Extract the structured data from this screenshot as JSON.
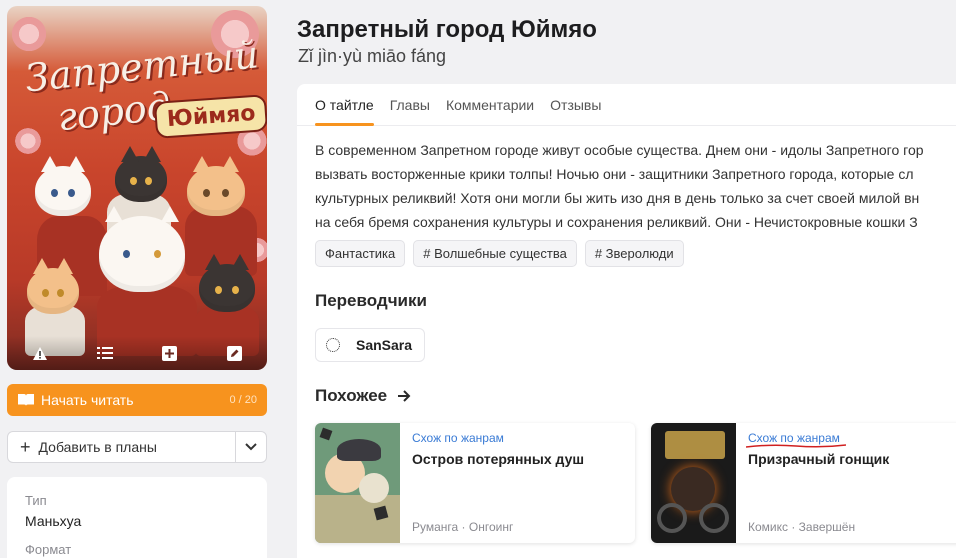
{
  "colors": {
    "accent": "#f7931e",
    "link": "#3a7bd5",
    "red_mark": "#d02020"
  },
  "cover": {
    "art_line1": "Запретный",
    "art_line2": "город",
    "art_badge": "Юймяо",
    "actions": [
      "warning-icon",
      "list-icon",
      "plus-square-icon",
      "edit-icon"
    ]
  },
  "read_button": {
    "label": "Начать читать",
    "progress": "0 / 20"
  },
  "plans_button": {
    "label": "Добавить в планы"
  },
  "info": [
    {
      "label": "Тип",
      "value": "Маньхуа"
    },
    {
      "label": "Формат",
      "value": ""
    }
  ],
  "header": {
    "title": "Запретный город Юймяо",
    "subtitle": "Zǐ jìn·yù miāo fáng"
  },
  "tabs": [
    "О тайтле",
    "Главы",
    "Комментарии",
    "Отзывы"
  ],
  "description": [
    "В современном Запретном городе живут особые существа. Днем они - идолы Запретного гор",
    "вызвать восторженные крики толпы! Ночью они - защитники Запретного города, которые сл",
    "культурных реликвий! Хотя они могли бы жить изо дня в день только за счет своей милой вн",
    "на себя бремя сохранения культуры и сохранения реликвий. Они - Нечистокровные кошки З"
  ],
  "tags": [
    "Фантастика",
    "# Волшебные существа",
    "# Зверолюди"
  ],
  "translators": {
    "heading": "Переводчики",
    "items": [
      {
        "name": "SanSara"
      }
    ]
  },
  "similar": {
    "heading": "Похожее",
    "items": [
      {
        "reason": "Схож по жанрам",
        "title": "Остров потерянных душ",
        "meta": "Руманга · Онгоинг"
      },
      {
        "reason": "Схож по жанрам",
        "title": "Призрачный гонщик",
        "meta": "Комикс · Завершён"
      }
    ]
  }
}
